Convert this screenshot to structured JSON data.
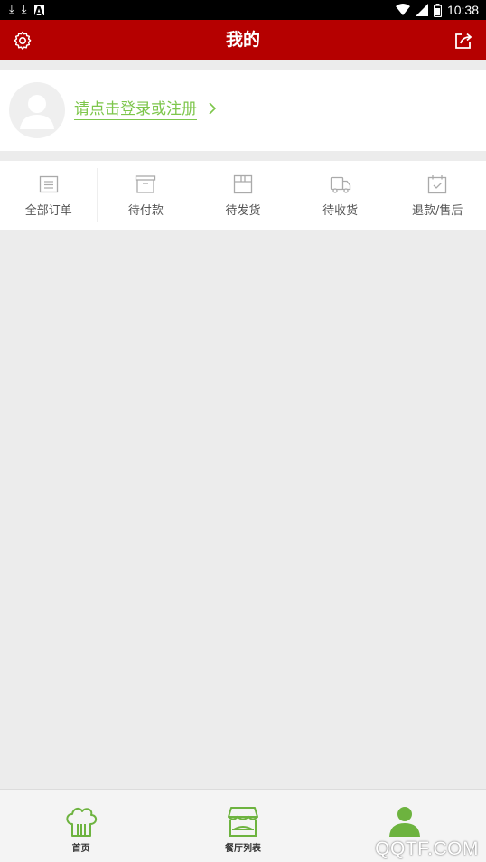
{
  "status_bar": {
    "time": "10:38"
  },
  "header": {
    "title": "我的",
    "settings_icon": "gear-icon",
    "share_icon": "share-icon"
  },
  "login": {
    "text": "请点击登录或注册"
  },
  "orders": [
    {
      "label": "全部订单",
      "icon": "order-list-icon"
    },
    {
      "label": "待付款",
      "icon": "box-icon"
    },
    {
      "label": "待发货",
      "icon": "package-icon"
    },
    {
      "label": "待收货",
      "icon": "truck-icon"
    },
    {
      "label": "退款/售后",
      "icon": "calendar-check-icon"
    }
  ],
  "bottom_nav": [
    {
      "label": "首页",
      "icon": "chef-hat-icon"
    },
    {
      "label": "餐厅列表",
      "icon": "restaurant-icon"
    },
    {
      "label": "",
      "icon": "user-icon"
    }
  ],
  "watermark": "QQTF.COM",
  "colors": {
    "header": "#b50000",
    "accent_green": "#7dc64b",
    "icon_gray": "#aaaaaa"
  }
}
